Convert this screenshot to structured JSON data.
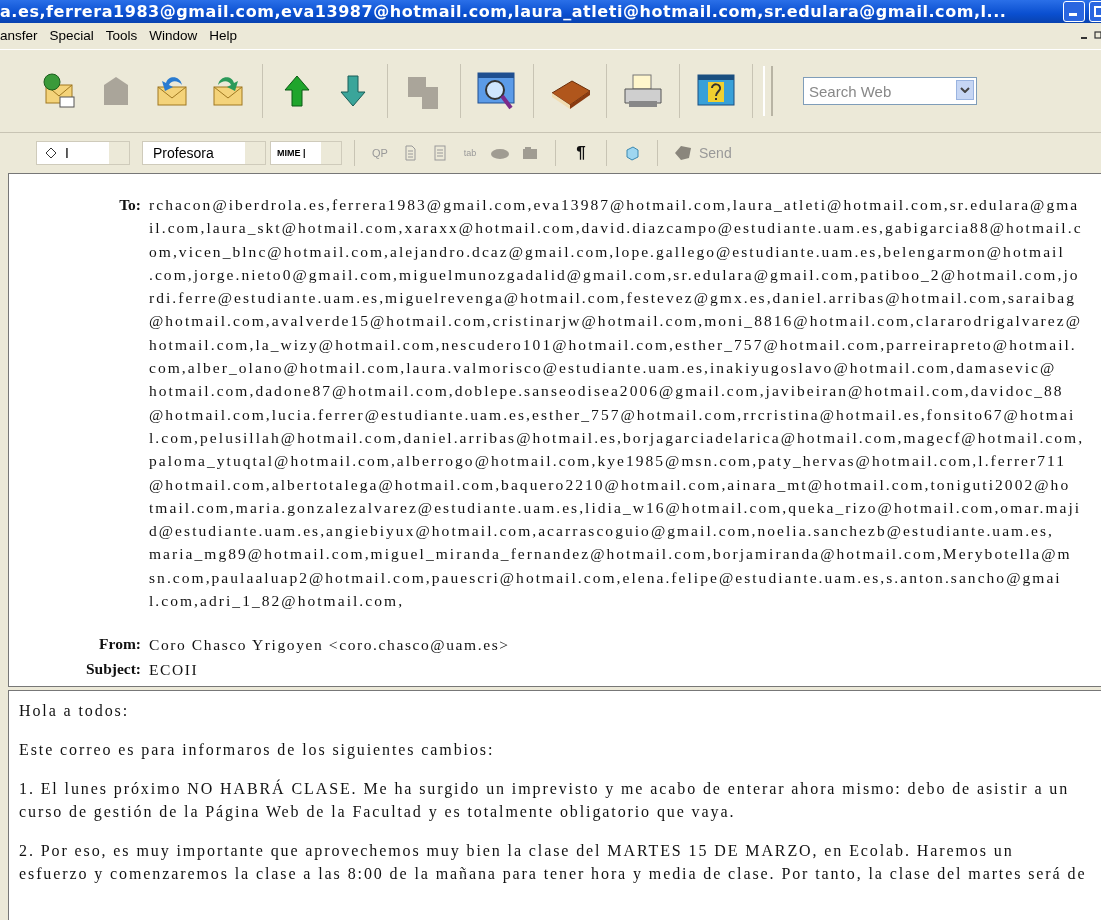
{
  "window": {
    "title": "a.es,ferrera1983@gmail.com,eva13987@hotmail.com,laura_atleti@hotmail.com,sr.edulara@gmail.com,l..."
  },
  "menu": [
    "ansfer",
    "Special",
    "Tools",
    "Window",
    "Help"
  ],
  "search": {
    "placeholder": "Search Web"
  },
  "format_bar": {
    "signature": "I",
    "personality": "Profesora",
    "encoding": "MIME |",
    "qp_label": "QP",
    "tab_label": "tab",
    "paragraph_mark": "¶",
    "send": {
      "label": "Send",
      "disabled": true
    }
  },
  "headers": {
    "to_label": "To:",
    "to_lines": [
      "rchacon@iberdrola.es,ferrera1983@gmail.com,eva13987@hotmail.com,laura_atleti@hotmail.com,sr.edulara@gma",
      "il.com,laura_skt@hotmail.com,xaraxx@hotmail.com,david.diazcampo@estudiante.uam.es,gabigarcia88@hotmail.c",
      "om,vicen_blnc@hotmail.com,alejandro.dcaz@gmail.com,lope.gallego@estudiante.uam.es,belengarmon@hotmail",
      ".com,jorge.nieto0@gmail.com,miguelmunozgadalid@gmail.com,sr.edulara@gmail.com,patiboo_2@hotmail.com,jo",
      "rdi.ferre@estudiante.uam.es,miguelrevenga@hotmail.com,festevez@gmx.es,daniel.arribas@hotmail.com,saraibag",
      "@hotmail.com,avalverde15@hotmail.com,cristinarjw@hotmail.com,moni_8816@hotmail.com,clararodrigalvarez@",
      "hotmail.com,la_wizy@hotmail.com,nescudero101@hotmail.com,esther_757@hotmail.com,parreirapreto@hotmail.",
      "com,alber_olano@hotmail.com,laura.valmorisco@estudiante.uam.es,inakiyugoslavo@hotmail.com,damasevic@",
      "hotmail.com,dadone87@hotmail.com,doblepe.sanseodisea2006@gmail.com,javibeiran@hotmail.com,davidoc_88",
      "@hotmail.com,lucia.ferrer@estudiante.uam.es,esther_757@hotmail.com,rrcristina@hotmail.es,fonsito67@hotmai",
      "l.com,pelusillah@hotmail.com,daniel.arribas@hotmail.es,borjagarciadelarica@hotmail.com,magecf@hotmail.com,",
      "paloma_ytuqtal@hotmail.com,alberrogo@hotmail.com,kye1985@msn.com,paty_hervas@hotmail.com,l.ferrer711",
      "@hotmail.com,albertotalega@hotmail.com,baquero2210@hotmail.com,ainara_mt@hotmail.com,toniguti2002@ho",
      "tmail.com,maria.gonzalezalvarez@estudiante.uam.es,lidia_w16@hotmail.com,queka_rizo@hotmail.com,omar.maji",
      "d@estudiante.uam.es,angiebiyux@hotmail.com,acarrascoguio@gmail.com,noelia.sanchezb@estudiante.uam.es,",
      "maria_mg89@hotmail.com,miguel_miranda_fernandez@hotmail.com,borjamiranda@hotmail.com,Merybotella@m",
      "sn.com,paulaaluap2@hotmail.com,pauescri@hotmail.com,elena.felipe@estudiante.uam.es,s.anton.sancho@gmai",
      "l.com,adri_1_82@hotmail.com,"
    ],
    "from_label": "From:",
    "from": "Coro Chasco Yrigoyen <coro.chasco@uam.es>",
    "subject_label": "Subject:",
    "subject": "ECOII"
  },
  "body": [
    [
      "Hola a todos:"
    ],
    [
      "Este correo es para informaros de los siguientes cambios:"
    ],
    [
      "1. El lunes próximo NO HABRÁ CLASE. Me ha surgido un imprevisto y me acabo de enterar ahora mismo: debo de asistir a un",
      "curso de gestión de la Página Web de la Facultad y es totalmente obligatorio que vaya."
    ],
    [
      "2. Por eso, es muy importante que aprovechemos muy bien la clase del MARTES 15 DE MARZO, en Ecolab. Haremos un",
      "esfuerzo y comenzaremos la clase a las 8:00 de la mañana para tener hora y media de clase. Por tanto, la clase del martes será de"
    ]
  ]
}
